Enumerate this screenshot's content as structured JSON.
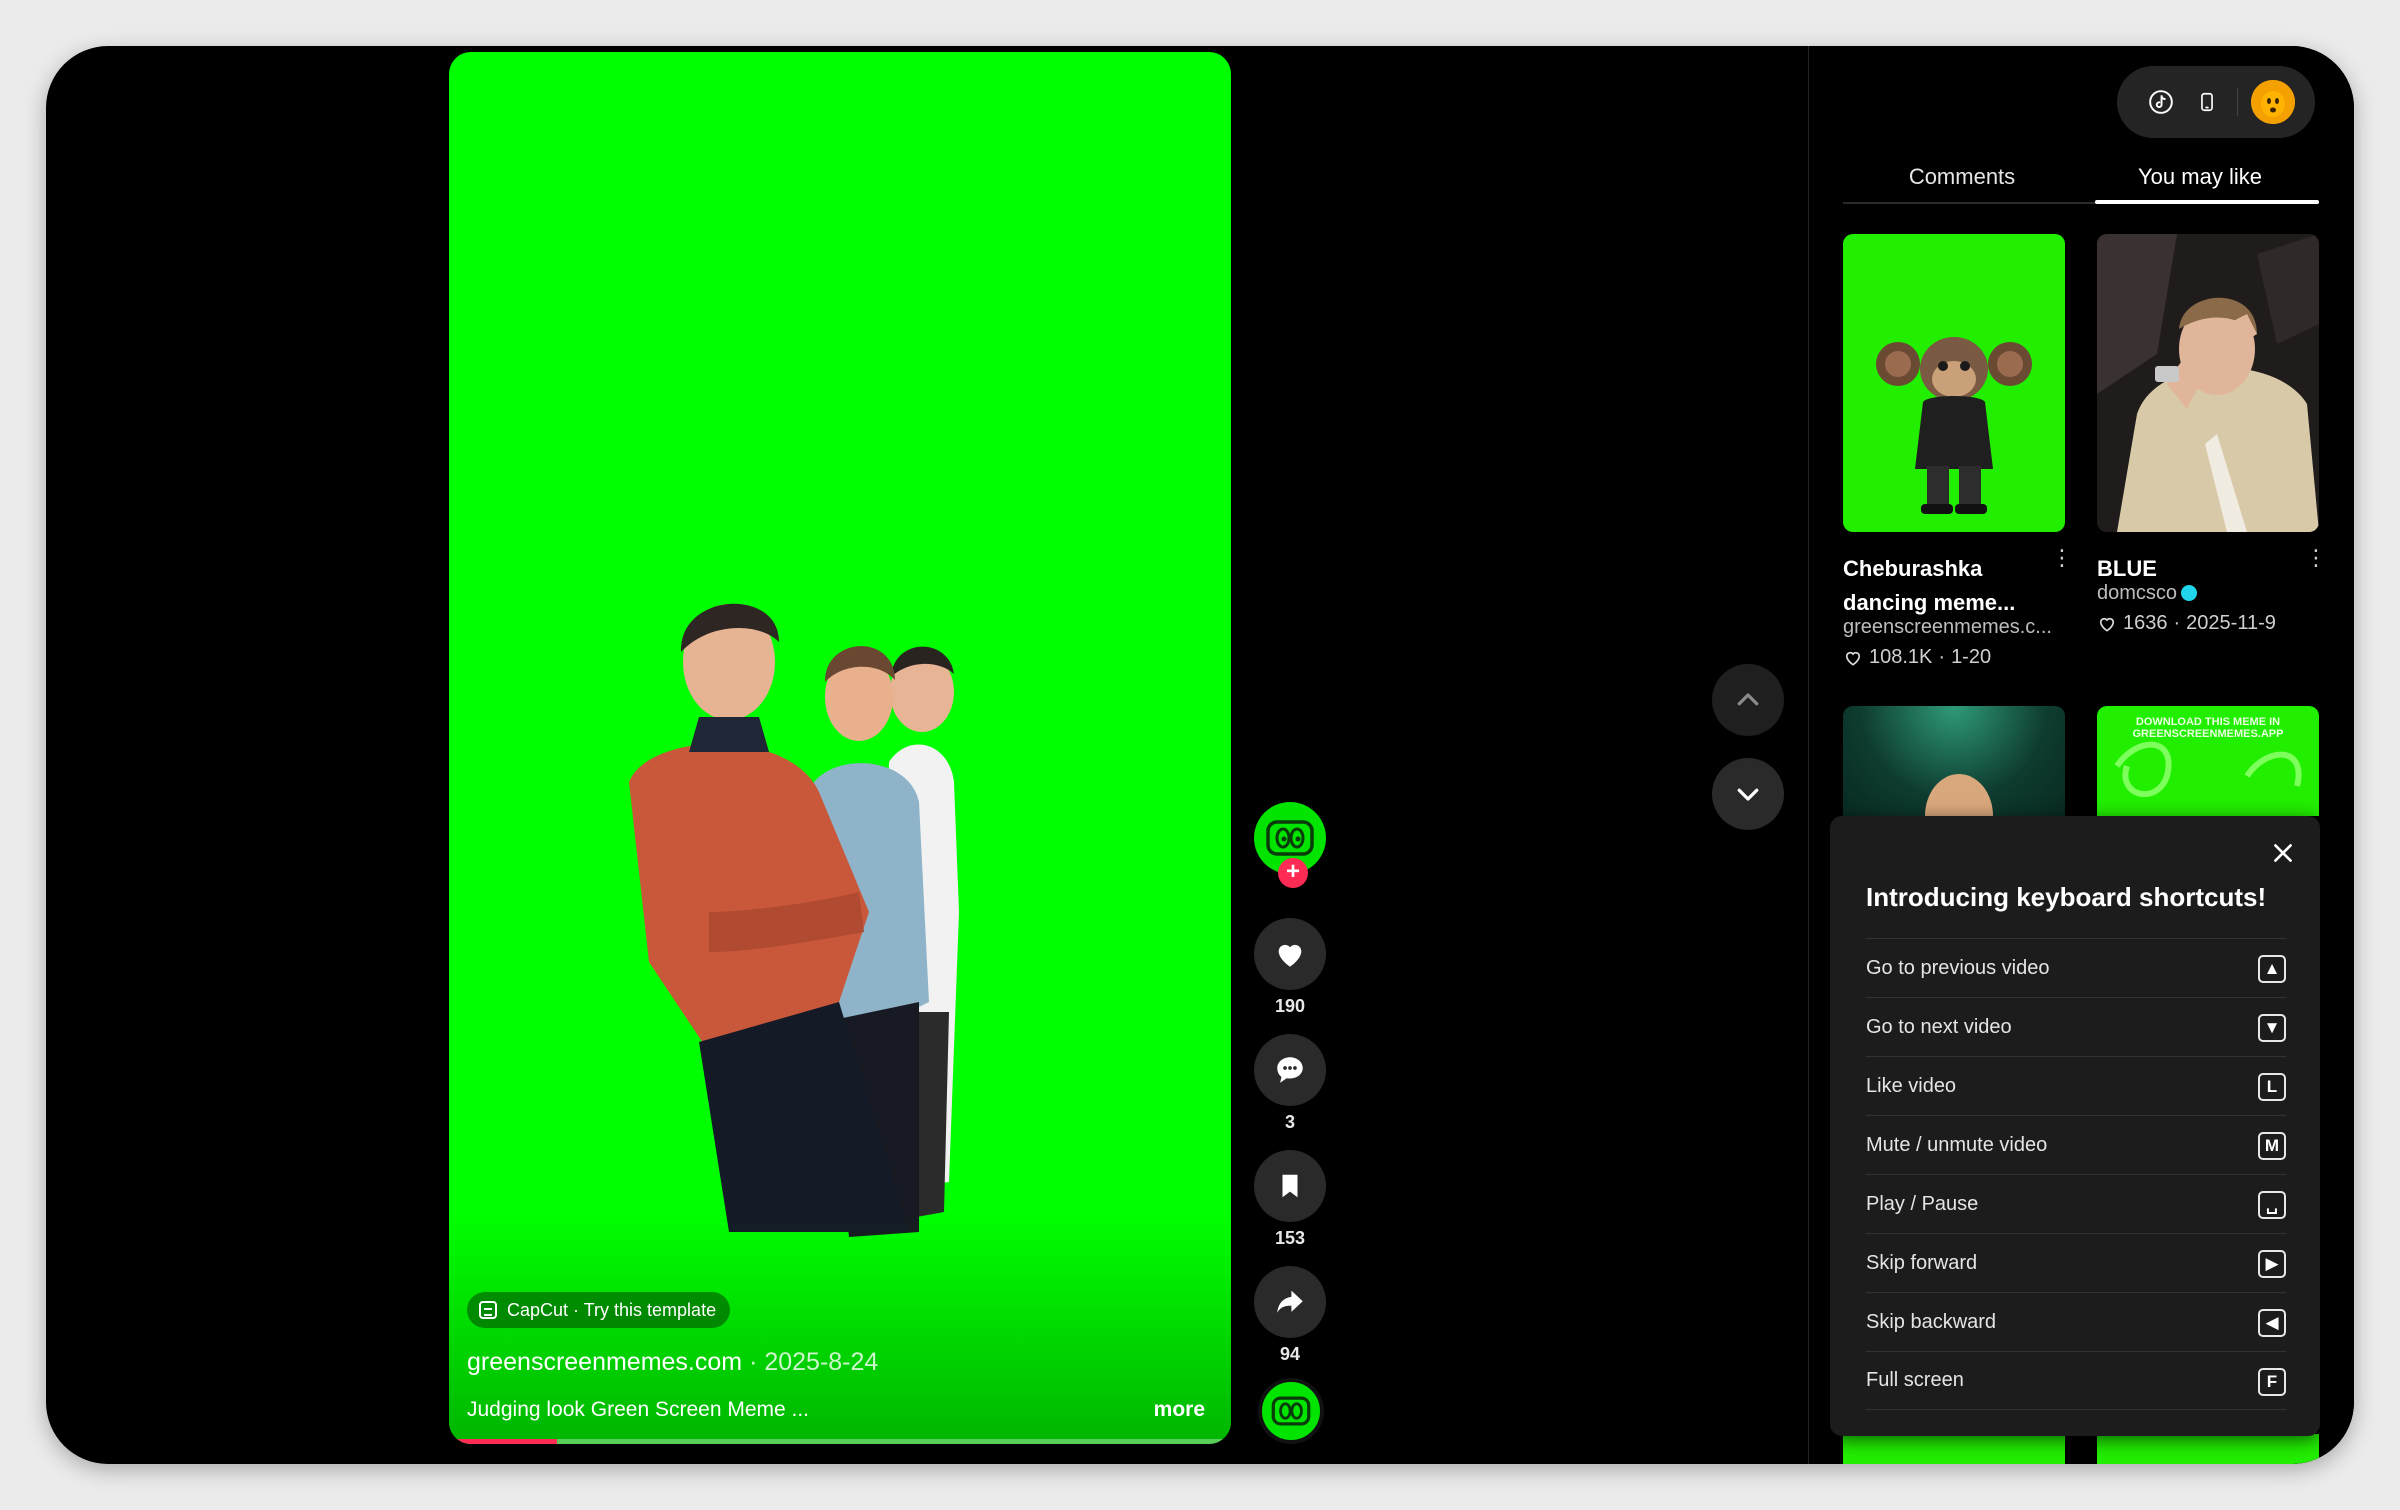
{
  "video": {
    "capcut_label": "CapCut · Try this template",
    "author": "greenscreenmemes.com",
    "date": " · 2025-8-24",
    "description": "Judging look Green Screen Meme ...",
    "more_label": "more",
    "progress_fraction": 0.13
  },
  "actions": {
    "likes": "190",
    "comments": "3",
    "saves": "153",
    "shares": "94",
    "follow_symbol": "+"
  },
  "panel": {
    "tabs": [
      {
        "label": "Comments",
        "active": false
      },
      {
        "label": "You may like",
        "active": true
      }
    ],
    "cards": [
      {
        "title": "Cheburashka dancing meme...",
        "author": "greenscreenmemes.c...",
        "likes": "108.1K",
        "date": "1-20",
        "verified": false
      },
      {
        "title": "BLUE",
        "author": "domcsco",
        "likes": "1636",
        "date": "2025-11-9",
        "verified": true
      }
    ],
    "thumb_watermark": "DOWNLOAD THIS MEME IN GREENSCREENMEMES.APP"
  },
  "shortcuts": {
    "title": "Introducing keyboard shortcuts!",
    "items": [
      {
        "label": "Go to previous video",
        "key": "▲"
      },
      {
        "label": "Go to next video",
        "key": "▼"
      },
      {
        "label": "Like video",
        "key": "L"
      },
      {
        "label": "Mute / unmute video",
        "key": "M"
      },
      {
        "label": "Play / Pause",
        "key": "␣"
      },
      {
        "label": "Skip forward",
        "key": "▶"
      },
      {
        "label": "Skip backward",
        "key": "◀"
      },
      {
        "label": "Full screen",
        "key": "F"
      }
    ]
  },
  "colors": {
    "screen_green": "#00ff00",
    "accent_red": "#fe2c55",
    "verified_blue": "#20d5ec"
  }
}
